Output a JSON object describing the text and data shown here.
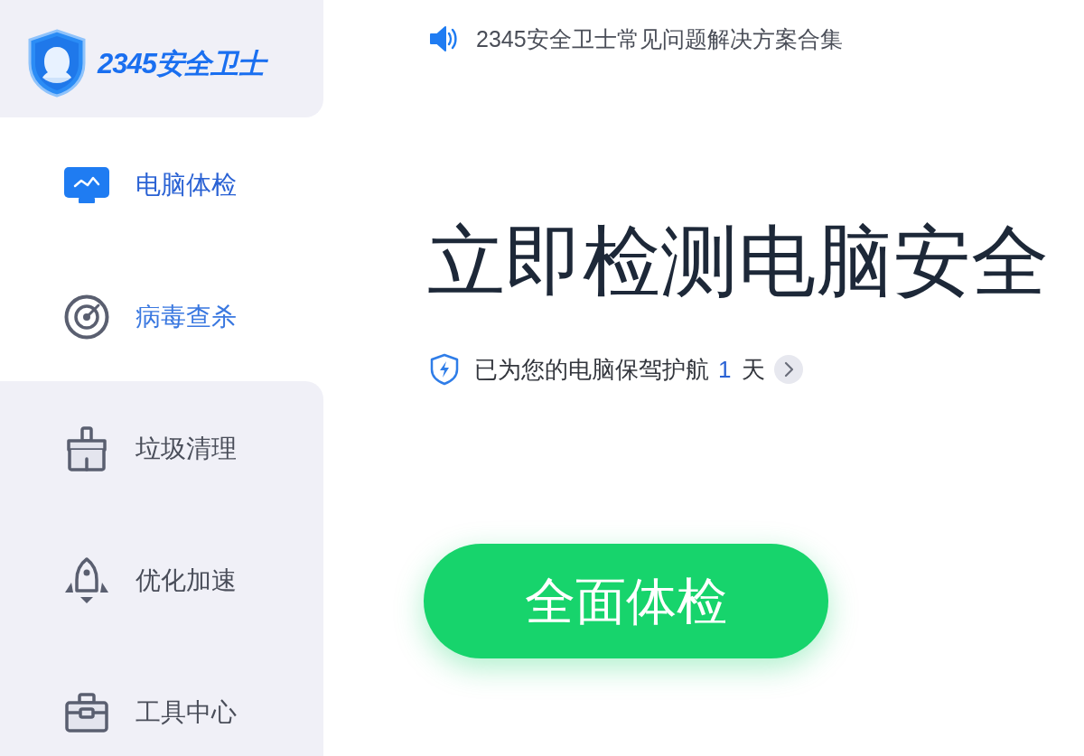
{
  "sidebar": {
    "logo": {
      "text": "2345安全卫士"
    },
    "items": [
      {
        "label": "电脑体检",
        "selected": true,
        "hovered": false
      },
      {
        "label": "病毒查杀",
        "selected": false,
        "hovered": true
      },
      {
        "label": "垃圾清理",
        "selected": false,
        "hovered": false
      },
      {
        "label": "优化加速",
        "selected": false,
        "hovered": false
      },
      {
        "label": "工具中心",
        "selected": false,
        "hovered": false
      }
    ]
  },
  "notice": {
    "text": "2345安全卫士常见问题解决方案合集"
  },
  "headline": "立即检测电脑安全",
  "protection": {
    "text": "已为您的电脑保驾护航",
    "days": "1",
    "unit": "天"
  },
  "scan_button": {
    "label": "全面体检"
  }
}
